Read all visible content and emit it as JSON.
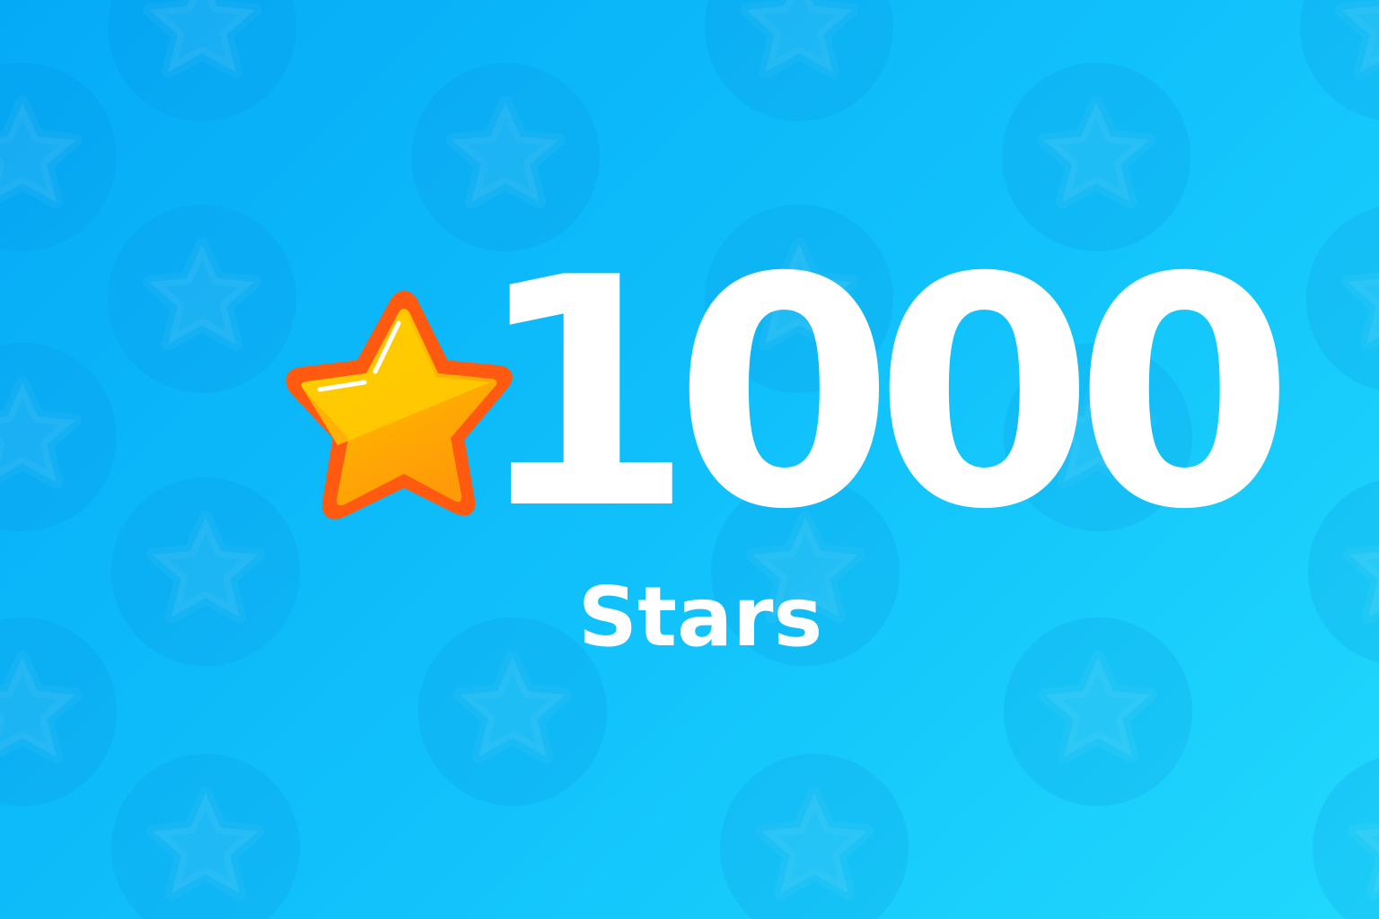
{
  "milestone": {
    "count": "1000",
    "unit": "Stars",
    "icon": "star-icon"
  },
  "colors": {
    "background_start": "#05aaf7",
    "background_end": "#20d9fd",
    "text": "#ffffff",
    "star_fill_top": "#ffca00",
    "star_fill_bottom": "#ff9f06",
    "star_outline": "#ff5a10",
    "pattern_circle": "#0aa6ee"
  }
}
